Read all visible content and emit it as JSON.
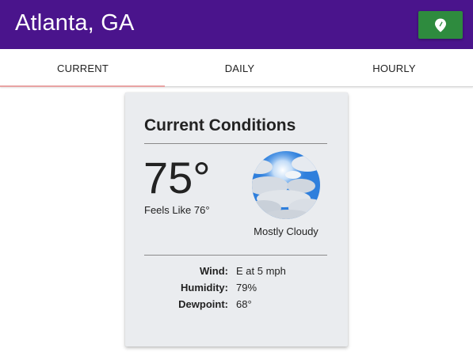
{
  "header": {
    "city": "Atlanta, GA",
    "location_button_icon": "map-pin-icon",
    "colors": {
      "bar": "#4a148c",
      "button": "#2e8b3e"
    }
  },
  "tabs": [
    {
      "label": "CURRENT",
      "active": true
    },
    {
      "label": "DAILY",
      "active": false
    },
    {
      "label": "HOURLY",
      "active": false
    }
  ],
  "current": {
    "title": "Current Conditions",
    "temperature": "75°",
    "feels_like": "Feels Like 76°",
    "condition_icon": "mostly-cloudy-sky-image",
    "condition": "Mostly Cloudy",
    "details": [
      {
        "label": "Wind:",
        "value": "E at 5 mph"
      },
      {
        "label": "Humidity:",
        "value": "79%"
      },
      {
        "label": "Dewpoint:",
        "value": "68°"
      }
    ]
  }
}
